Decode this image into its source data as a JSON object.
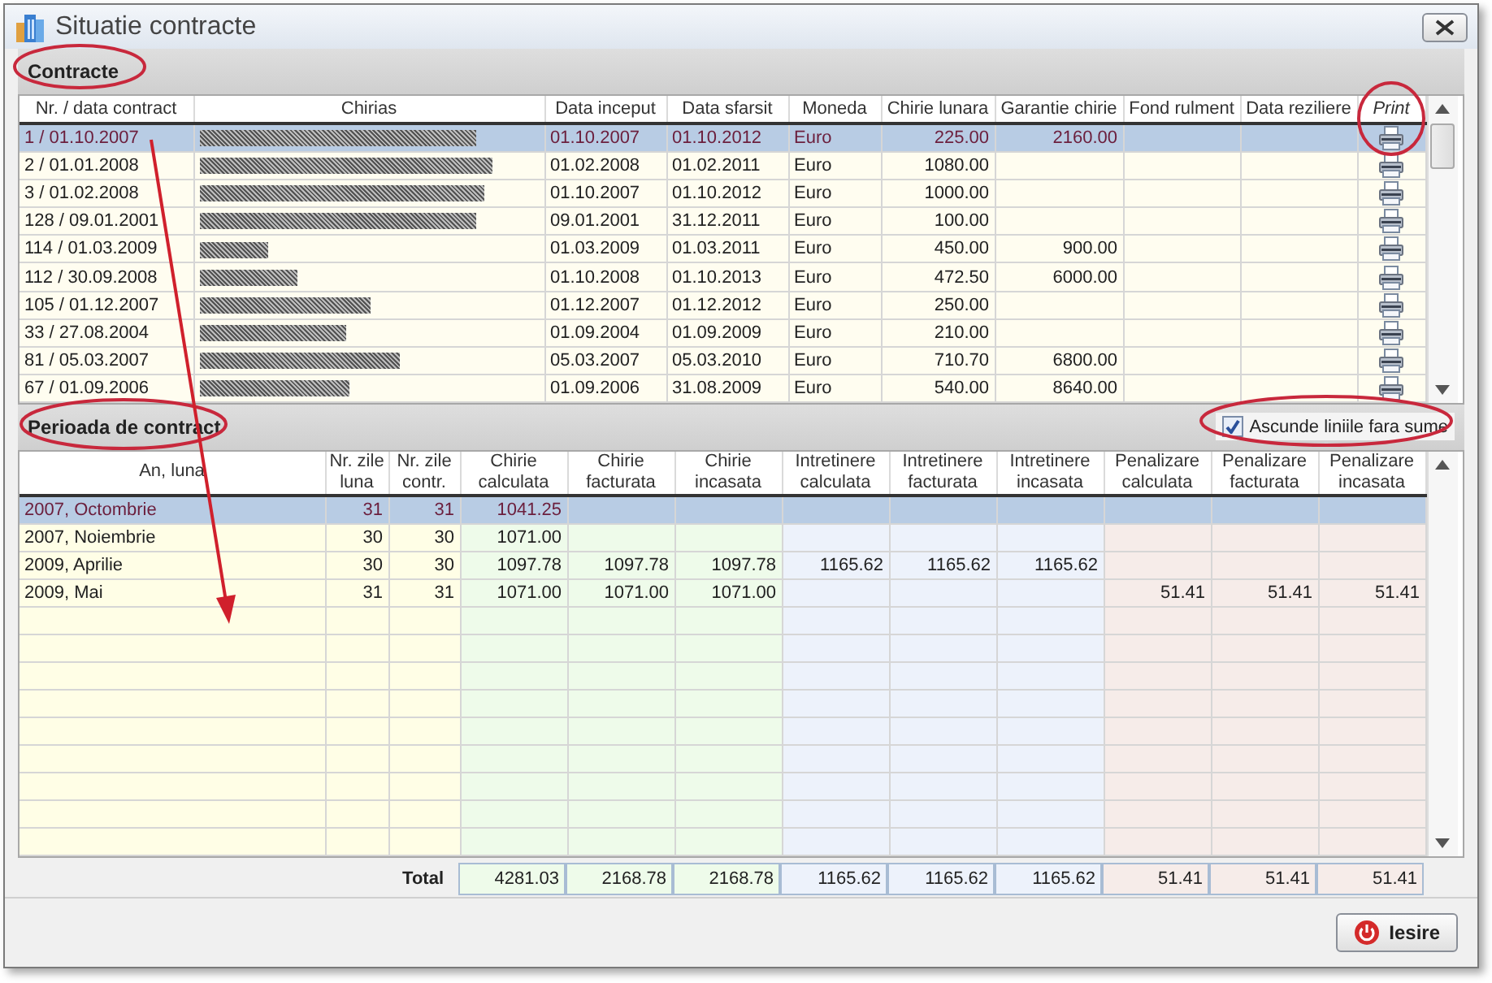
{
  "window": {
    "title": "Situatie contracte"
  },
  "contracts_section": {
    "title": "Contracte"
  },
  "contracts_table": {
    "columns": [
      {
        "label": "Nr. / data contract",
        "kind": "text"
      },
      {
        "label": "Chirias",
        "kind": "redacted"
      },
      {
        "label": "Data inceput",
        "kind": "text"
      },
      {
        "label": "Data sfarsit",
        "kind": "text"
      },
      {
        "label": "Moneda",
        "kind": "text"
      },
      {
        "label": "Chirie lunara",
        "kind": "number"
      },
      {
        "label": "Garantie chirie",
        "kind": "number"
      },
      {
        "label": "Fond rulment",
        "kind": "number"
      },
      {
        "label": "Data reziliere",
        "kind": "text"
      },
      {
        "label": "Print",
        "kind": "print"
      }
    ],
    "rows": [
      {
        "selected": true,
        "cells": [
          "1 / 01.10.2007",
          null,
          "01.10.2007",
          "01.10.2012",
          "Euro",
          "225.00",
          "2160.00",
          null,
          null,
          null
        ]
      },
      {
        "selected": false,
        "cells": [
          "2 / 01.01.2008",
          null,
          "01.02.2008",
          "01.02.2011",
          "Euro",
          "1080.00",
          null,
          null,
          null,
          null
        ]
      },
      {
        "selected": false,
        "cells": [
          "3 / 01.02.2008",
          null,
          "01.10.2007",
          "01.10.2012",
          "Euro",
          "1000.00",
          null,
          null,
          null,
          null
        ]
      },
      {
        "selected": false,
        "cells": [
          "128 / 09.01.2001",
          null,
          "09.01.2001",
          "31.12.2011",
          "Euro",
          "100.00",
          null,
          null,
          null,
          null
        ]
      },
      {
        "selected": false,
        "cells": [
          "114 / 01.03.2009",
          null,
          "01.03.2009",
          "01.03.2011",
          "Euro",
          "450.00",
          "900.00",
          null,
          null,
          null
        ]
      },
      {
        "selected": false,
        "cells": [
          "112 / 30.09.2008",
          null,
          "01.10.2008",
          "01.10.2013",
          "Euro",
          "472.50",
          "6000.00",
          null,
          null,
          null
        ]
      },
      {
        "selected": false,
        "cells": [
          "105 / 01.12.2007",
          null,
          "01.12.2007",
          "01.12.2012",
          "Euro",
          "250.00",
          null,
          null,
          null,
          null
        ]
      },
      {
        "selected": false,
        "cells": [
          "33 / 27.08.2004",
          null,
          "01.09.2004",
          "01.09.2009",
          "Euro",
          "210.00",
          null,
          null,
          null,
          null
        ]
      },
      {
        "selected": false,
        "cells": [
          "81 / 05.03.2007",
          null,
          "05.03.2007",
          "05.03.2010",
          "Euro",
          "710.70",
          "6800.00",
          null,
          null,
          null
        ]
      },
      {
        "selected": false,
        "cells": [
          "67 / 01.09.2006",
          null,
          "01.09.2006",
          "31.08.2009",
          "Euro",
          "540.00",
          "8640.00",
          null,
          null,
          null
        ]
      }
    ]
  },
  "period_section": {
    "title": "Perioada de contract",
    "hide_empty": {
      "label": "Ascunde liniile fara sume",
      "checked": true
    }
  },
  "period_table": {
    "columns": [
      {
        "label": "An, luna",
        "kind": "period"
      },
      {
        "label": "Nr. zile luna",
        "kind": "days"
      },
      {
        "label": "Nr. zile contr.",
        "kind": "days"
      },
      {
        "label": "Chirie calculata",
        "kind": "rent"
      },
      {
        "label": "Chirie facturata",
        "kind": "rent"
      },
      {
        "label": "Chirie incasata",
        "kind": "rent"
      },
      {
        "label": "Intretinere calculata",
        "kind": "maintenance"
      },
      {
        "label": "Intretinere facturata",
        "kind": "maintenance"
      },
      {
        "label": "Intretinere incasata",
        "kind": "maintenance"
      },
      {
        "label": "Penalizare calculata",
        "kind": "penalty"
      },
      {
        "label": "Penalizare facturata",
        "kind": "penalty"
      },
      {
        "label": "Penalizare incasata",
        "kind": "penalty"
      }
    ],
    "rows": [
      {
        "selected": true,
        "cells": [
          "2007, Octombrie",
          "31",
          "31",
          "1041.25",
          null,
          null,
          null,
          null,
          null,
          null,
          null,
          null
        ]
      },
      {
        "selected": false,
        "cells": [
          "2007, Noiembrie",
          "30",
          "30",
          "1071.00",
          null,
          null,
          null,
          null,
          null,
          null,
          null,
          null
        ]
      },
      {
        "selected": false,
        "cells": [
          "2009, Aprilie",
          "30",
          "30",
          "1097.78",
          "1097.78",
          "1097.78",
          "1165.62",
          "1165.62",
          "1165.62",
          null,
          null,
          null
        ]
      },
      {
        "selected": false,
        "cells": [
          "2009, Mai",
          "31",
          "31",
          "1071.00",
          "1071.00",
          "1071.00",
          null,
          null,
          null,
          "51.41",
          "51.41",
          "51.41"
        ]
      }
    ],
    "total": {
      "label": "Total",
      "values": [
        "4281.03",
        "2168.78",
        "2168.78",
        "1165.62",
        "1165.62",
        "1165.62",
        "51.41",
        "51.41",
        "51.41"
      ]
    }
  },
  "buttons": [
    {
      "label": "Iesire",
      "kind": "exit"
    }
  ]
}
